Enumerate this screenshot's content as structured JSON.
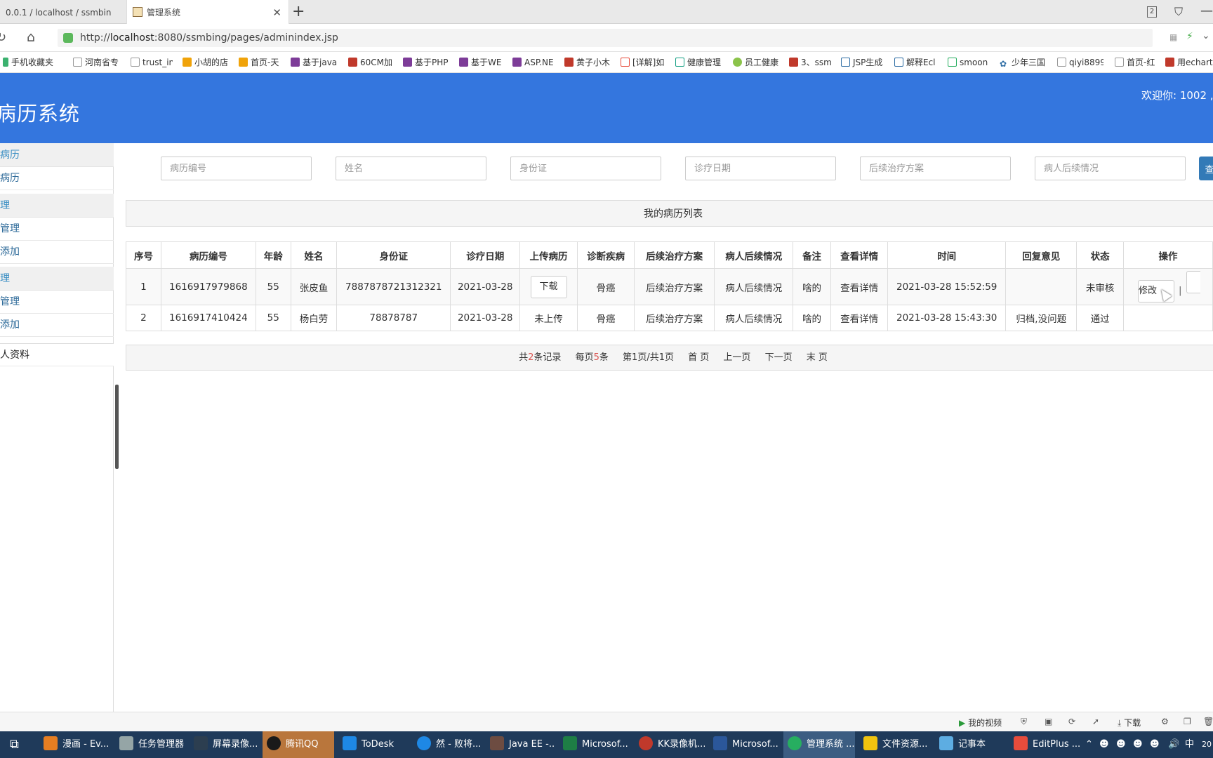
{
  "browser": {
    "tabs": [
      {
        "title": "0.0.1 / localhost / ssmbin",
        "active": false
      },
      {
        "title": "管理系统",
        "active": true
      }
    ],
    "url_prefix": "http://",
    "url_host": "localhost",
    "url_rest": ":8080/ssmbing/pages/adminindex.jsp",
    "window_badge": "2",
    "bookmarks": [
      "手机收藏夹",
      "河南省专",
      "trust_in",
      "小胡的店",
      "首页-天",
      "基于java",
      "60CM加",
      "基于PHP",
      "基于WE",
      "ASP.NE",
      "黄子小木",
      "[详解]如",
      "健康管理",
      "员工健康",
      "3、ssm",
      "JSP生成",
      "解释Ecl",
      "smoon",
      "少年三国",
      "qiyi8899",
      "首页-红",
      "用echart"
    ]
  },
  "header": {
    "title": "病历系统",
    "welcome": "欢迎你: 1002 ,"
  },
  "sidebar": {
    "sections": [
      {
        "heading": "病历",
        "items": [
          "病历"
        ]
      },
      {
        "heading": "理",
        "items": [
          "管理",
          "添加"
        ]
      },
      {
        "heading": "理",
        "items": [
          "管理",
          "添加"
        ]
      }
    ],
    "profile": "人资料"
  },
  "search": {
    "placeholders": [
      "病历编号",
      "姓名",
      "身份证",
      "诊疗日期",
      "后续治疗方案",
      "病人后续情况"
    ],
    "button": "查"
  },
  "panel": {
    "title": "我的病历列表"
  },
  "table": {
    "headers": [
      "序号",
      "病历编号",
      "年龄",
      "姓名",
      "身份证",
      "诊疗日期",
      "上传病历",
      "诊断疾病",
      "后续治疗方案",
      "病人后续情况",
      "备注",
      "查看详情",
      "时间",
      "回复意见",
      "状态",
      "操作"
    ],
    "rows": [
      {
        "no": "1",
        "record_id": "1616917979868",
        "age": "55",
        "name": "张皮鱼",
        "id_card": "7887878721312321",
        "date": "2021-03-28",
        "upload": "下载",
        "disease": "骨癌",
        "plan": "后续治疗方案",
        "followup": "病人后续情况",
        "note": "啥的",
        "detail": "查看详情",
        "time": "2021-03-28 15:52:59",
        "reply": "",
        "status": "未审核",
        "action": "修改",
        "sep": "|"
      },
      {
        "no": "2",
        "record_id": "1616917410424",
        "age": "55",
        "name": "杨白劳",
        "id_card": "78878787",
        "date": "2021-03-28",
        "upload": "未上传",
        "disease": "骨癌",
        "plan": "后续治疗方案",
        "followup": "病人后续情况",
        "note": "啥的",
        "detail": "查看详情",
        "time": "2021-03-28 15:43:30",
        "reply": "归档,没问题",
        "status": "通过",
        "action": "",
        "sep": ""
      }
    ]
  },
  "pager": {
    "total_pre": "共",
    "total_num": "2",
    "total_post": "条记录",
    "per_pre": "每页",
    "per_num": "5",
    "per_post": "条",
    "page_pre": "第",
    "page_num": "1",
    "page_mid": "页/共",
    "page_total": "1",
    "page_post": "页",
    "first": "首 页",
    "prev": "上一页",
    "next": "下一页",
    "last": "末 页"
  },
  "statusbar": {
    "my_video": "我的视频",
    "download": "下载"
  },
  "taskbar": {
    "items": [
      "漫画 - Ev...",
      "任务管理器",
      "屏幕录像...",
      "腾讯QQ",
      "ToDesk",
      "然 - 败将...",
      "Java EE -...",
      "Microsof...",
      "KK录像机...",
      "Microsof...",
      "管理系统 ...",
      "文件资源...",
      "记事本",
      "EditPlus ..."
    ],
    "ime": "中",
    "clock": "20"
  },
  "colors": {
    "header_bg": "#3476de",
    "sidebar_link": "#3a8ec3",
    "search_button": "#337ab7",
    "pager_highlight": "#d9534f",
    "taskbar_bg": "#1f3a5a"
  }
}
